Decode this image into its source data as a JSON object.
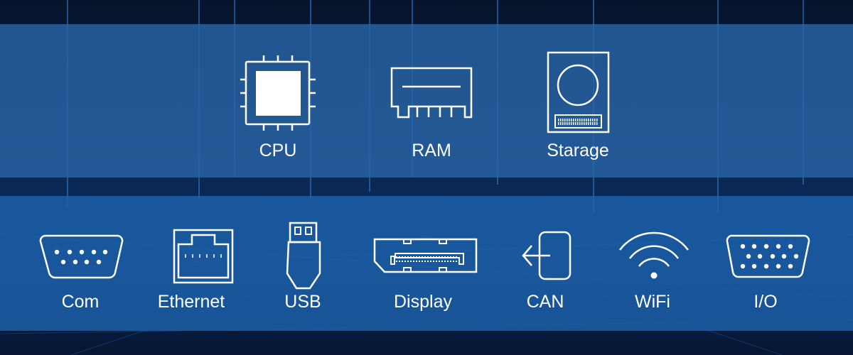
{
  "colors": {
    "background": "#0a2248",
    "top_band": "#28649f",
    "bottom_band": "#1e64af",
    "icon": "#ffffff"
  },
  "top_row": [
    {
      "label": "CPU",
      "icon": "cpu-chip-icon"
    },
    {
      "label": "RAM",
      "icon": "ram-module-icon"
    },
    {
      "label": "Starage",
      "icon": "storage-drive-icon"
    }
  ],
  "bottom_row": [
    {
      "label": "Com",
      "icon": "serial-port-icon"
    },
    {
      "label": "Ethernet",
      "icon": "ethernet-port-icon"
    },
    {
      "label": "USB",
      "icon": "usb-plug-icon"
    },
    {
      "label": "Display",
      "icon": "displayport-icon"
    },
    {
      "label": "CAN",
      "icon": "can-bus-icon"
    },
    {
      "label": "WiFi",
      "icon": "wifi-icon"
    },
    {
      "label": "I/O",
      "icon": "vga-io-port-icon"
    }
  ]
}
